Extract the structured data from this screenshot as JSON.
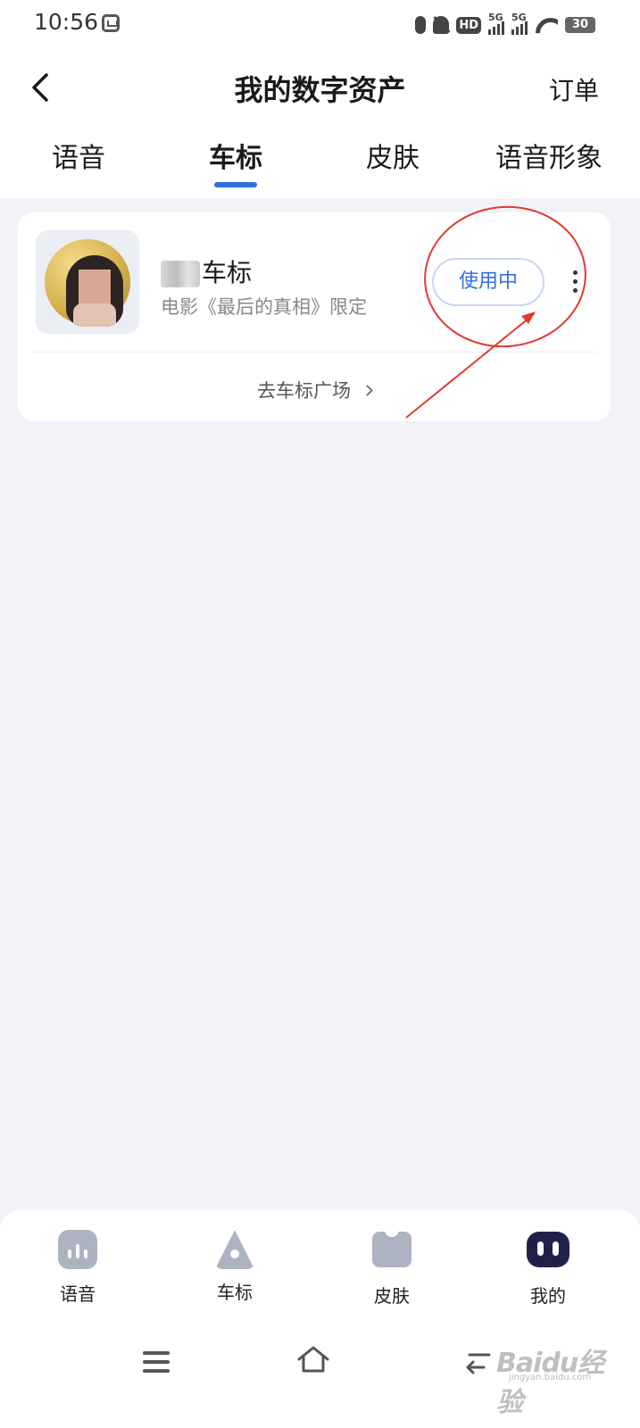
{
  "status_bar": {
    "time": "10:56",
    "network_1": "5G",
    "network_2": "5G",
    "hd": "HD",
    "battery": "30"
  },
  "header": {
    "title": "我的数字资产",
    "orders_label": "订单"
  },
  "tabs": [
    {
      "label": "语音",
      "active": false
    },
    {
      "label": "车标",
      "active": true
    },
    {
      "label": "皮肤",
      "active": false
    },
    {
      "label": "语音形象",
      "active": false
    }
  ],
  "asset_card": {
    "name_visible": "车标",
    "description": "电影《最后的真相》限定",
    "status_button": "使用中",
    "plaza_link": "去车标广场"
  },
  "bottom_nav": [
    {
      "label": "语音",
      "icon": "voice-icon"
    },
    {
      "label": "车标",
      "icon": "car-logo-icon"
    },
    {
      "label": "皮肤",
      "icon": "skin-icon"
    },
    {
      "label": "我的",
      "icon": "mine-icon",
      "active": true
    }
  ],
  "watermark": {
    "brand": "Baidu经验",
    "url": "jingyan.baidu.com"
  },
  "colors": {
    "accent": "#2f6fe4",
    "annotation": "#e03a2f",
    "background": "#f2f3f8"
  }
}
